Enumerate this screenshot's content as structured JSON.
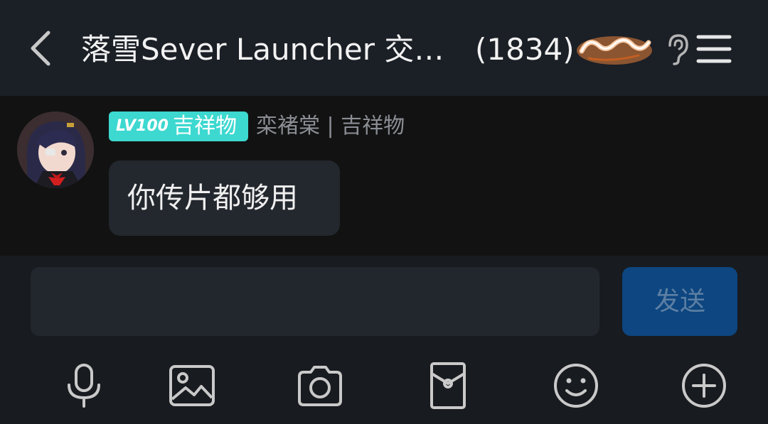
{
  "header": {
    "back_icon": "chevron-left-icon",
    "title": "落雪Sever Launcher 交…",
    "count": "(1834)",
    "badge_icon": "que-sera-badge-icon",
    "ear_icon": "ear-icon",
    "menu_icon": "hamburger-menu-icon"
  },
  "message": {
    "level": "LV100",
    "member_title": "吉祥物",
    "nickname": "栾褚棠 | 吉祥物",
    "text": "你传片都够用",
    "badge_color": "#3dd8d0"
  },
  "composer": {
    "input_value": "",
    "send_label": "发送",
    "send_color": "#0d4680"
  },
  "toolbar": [
    {
      "icon": "microphone-icon"
    },
    {
      "icon": "image-icon"
    },
    {
      "icon": "camera-icon"
    },
    {
      "icon": "red-packet-icon"
    },
    {
      "icon": "emoji-icon"
    },
    {
      "icon": "plus-circle-icon"
    }
  ]
}
